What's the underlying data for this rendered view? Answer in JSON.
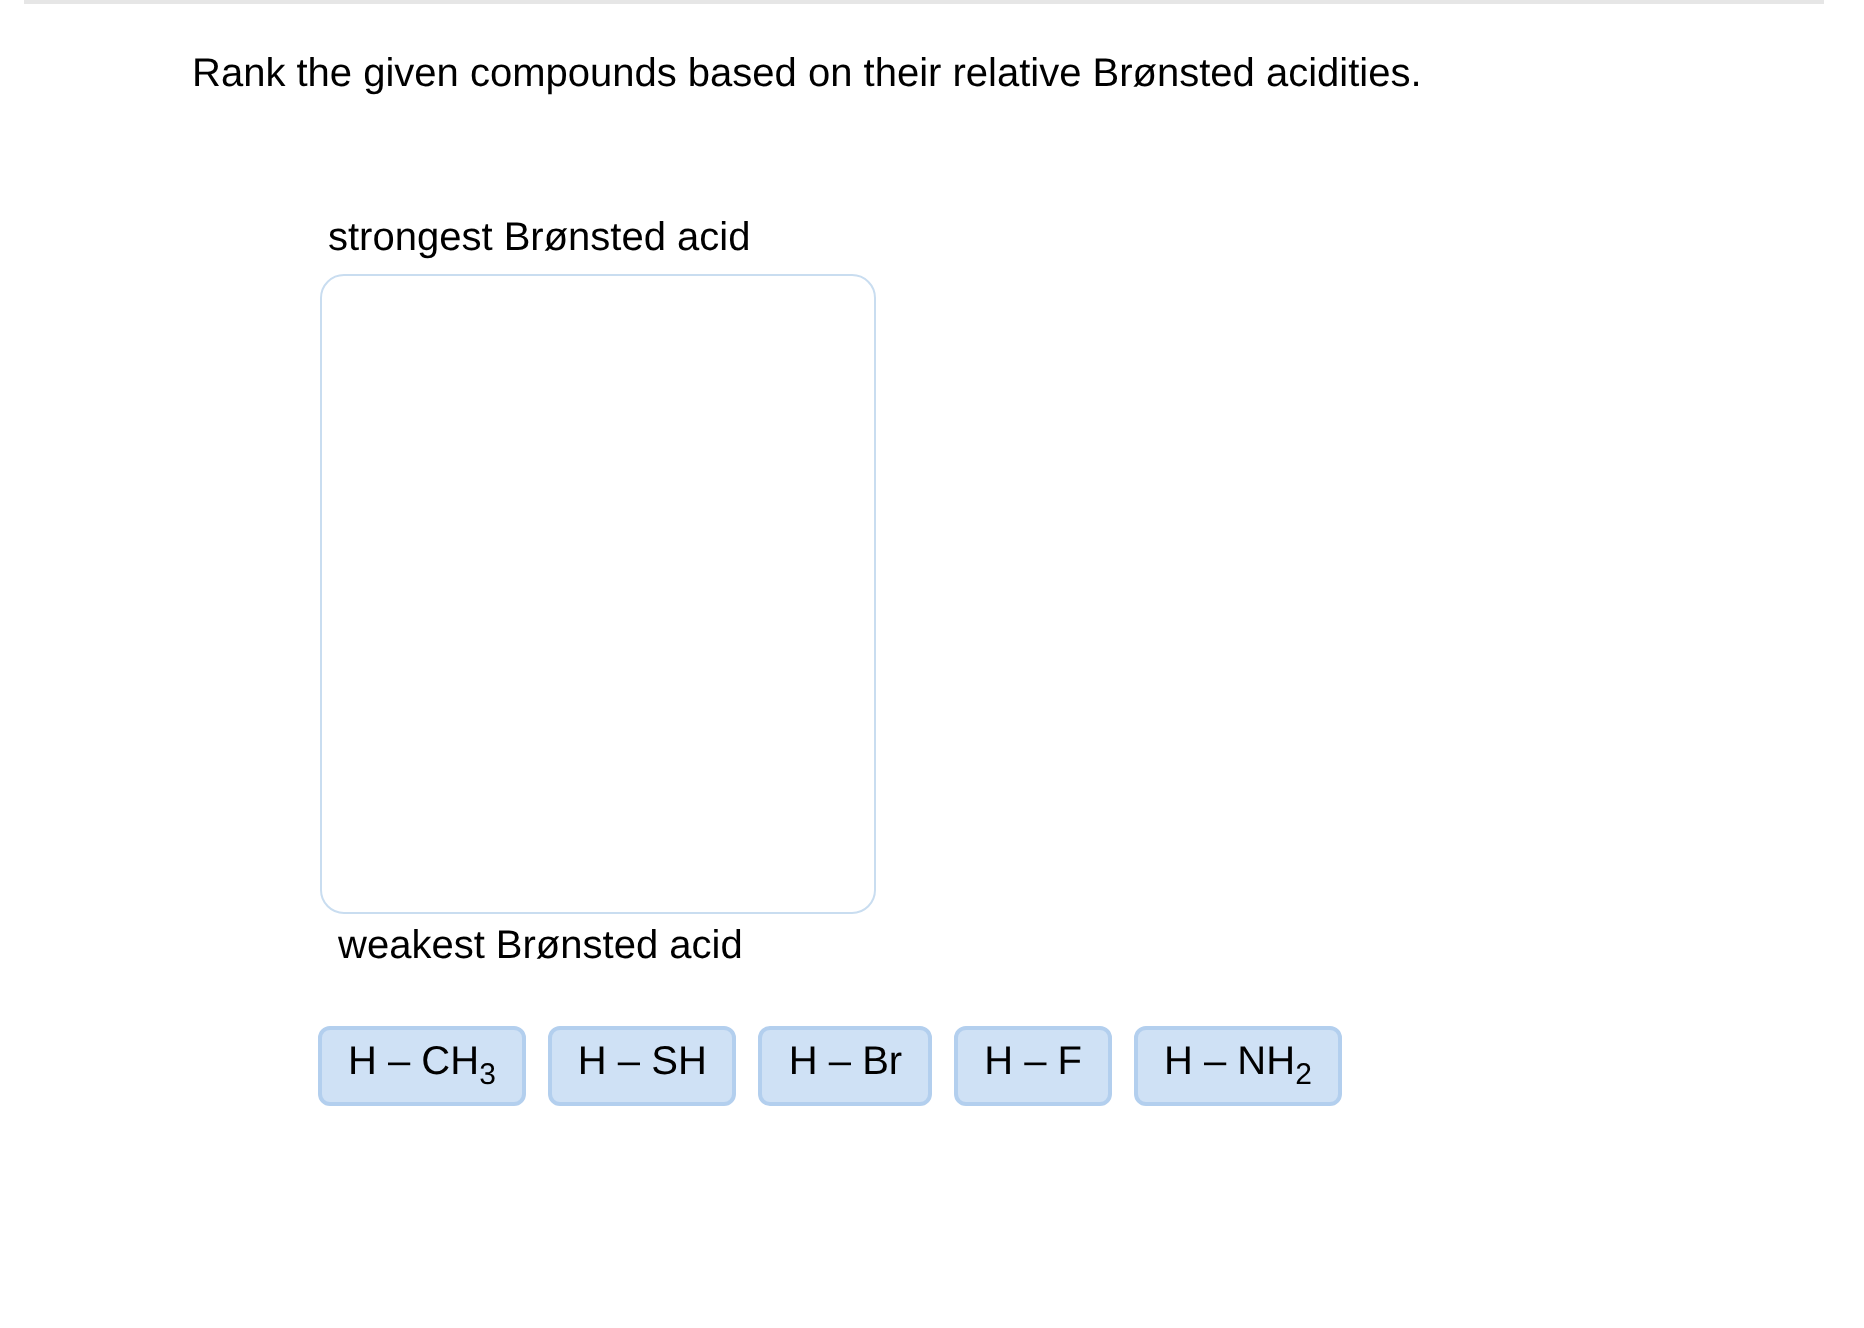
{
  "question": "Rank the given compounds based on their relative Brønsted acidities.",
  "ranking": {
    "top_label": "strongest Brønsted acid",
    "bottom_label": "weakest Brønsted acid"
  },
  "chips": [
    "H – CH$_{3}$",
    "H – SH",
    "H – Br",
    "H – F",
    "H – NH$_{2}$"
  ]
}
